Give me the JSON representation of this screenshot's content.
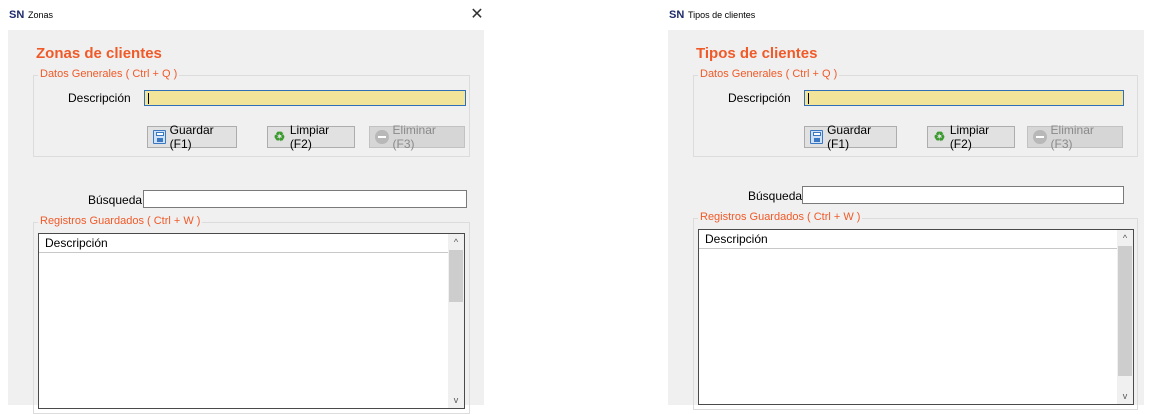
{
  "windows": [
    {
      "title": "Zonas",
      "logo": "SN",
      "close": "✕",
      "heading": "Zonas de clientes",
      "datos_generales": "Datos Generales ( Ctrl + Q )",
      "descripcion_label": "Descripción",
      "buttons": {
        "guardar": "Guardar (F1)",
        "limpiar": "Limpiar (F2)",
        "eliminar": "Eliminar (F3)"
      },
      "busqueda_label": "Búsqueda",
      "registros": "Registros Guardados ( Ctrl + W )",
      "grid_header": "Descripción"
    },
    {
      "title": "Tipos de clientes",
      "logo": "SN",
      "close": "✕",
      "heading": "Tipos de clientes",
      "datos_generales": "Datos Generales ( Ctrl + Q )",
      "descripcion_label": "Descripción",
      "buttons": {
        "guardar": "Guardar (F1)",
        "limpiar": "Limpiar (F2)",
        "eliminar": "Eliminar (F3)"
      },
      "busqueda_label": "Búsqueda",
      "registros": "Registros Guardados ( Ctrl + W )",
      "grid_header": "Descripción"
    }
  ],
  "scroll_up_glyph": "^",
  "scroll_down_glyph": "v",
  "colors": {
    "accent": "#f05a28",
    "highlight_field": "#f2e59a",
    "panel_bg": "#f0f0f0"
  }
}
